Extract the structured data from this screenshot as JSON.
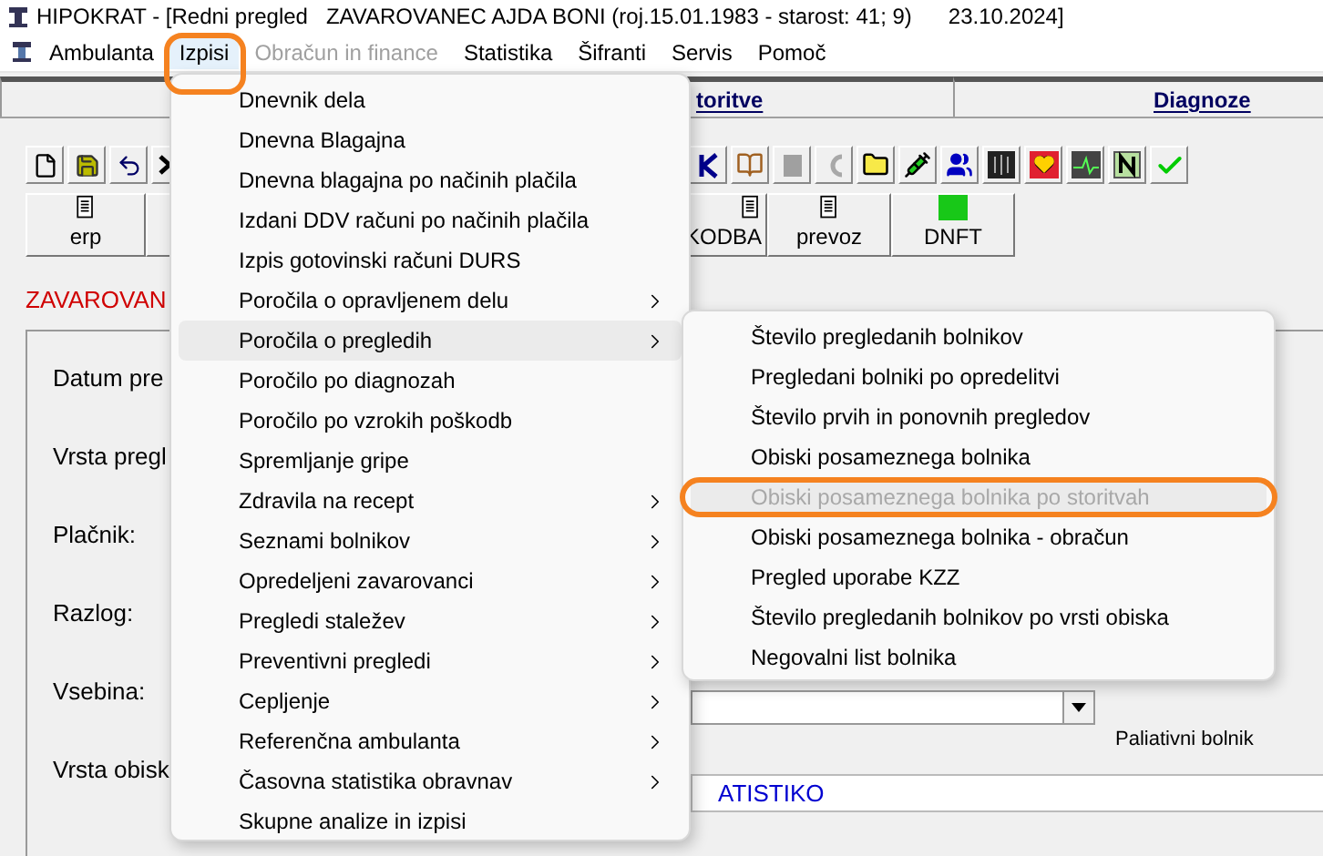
{
  "window": {
    "title": "HIPOKRAT - [Redni pregled   ZAVAROVANEC AJDA BONI (roj.15.01.1983 - starost: 41; 9)      23.10.2024]"
  },
  "menu_bar": [
    {
      "label": "Ambulanta",
      "selected": false,
      "disabled": false
    },
    {
      "label": "Izpisi",
      "selected": true,
      "disabled": false
    },
    {
      "label": "Obračun in finance",
      "selected": false,
      "disabled": true
    },
    {
      "label": "Statistika",
      "selected": false,
      "disabled": false
    },
    {
      "label": "Šifranti",
      "selected": false,
      "disabled": false
    },
    {
      "label": "Servis",
      "selected": false,
      "disabled": false
    },
    {
      "label": "Pomoč",
      "selected": false,
      "disabled": false
    }
  ],
  "tabs": [
    {
      "label": "toritve"
    },
    {
      "label": "Diagnoze"
    }
  ],
  "buttons": [
    {
      "label": "erp"
    },
    {
      "label": "KODBA"
    },
    {
      "label": "prevoz"
    },
    {
      "label": "DNFT",
      "kind": "green"
    }
  ],
  "banner": "ZAVAROVAN",
  "form_labels": [
    "Datum pre",
    "Vrsta pregl",
    "Plačnik:",
    "Razlog:",
    "Vsebina:",
    "Vrsta obisk"
  ],
  "checkbox_label": "Paliativni bolnik",
  "visit_type_field": {
    "value": "ATISTIKO"
  },
  "izpisi_menu": [
    {
      "label": "Dnevnik dela",
      "submenu": false,
      "highlighted": false
    },
    {
      "label": "Dnevna Blagajna",
      "submenu": false,
      "highlighted": false
    },
    {
      "label": "Dnevna blagajna po načinih plačila",
      "submenu": false,
      "highlighted": false
    },
    {
      "label": "Izdani DDV računi po načinih plačila",
      "submenu": false,
      "highlighted": false
    },
    {
      "label": "Izpis gotovinski računi DURS",
      "submenu": false,
      "highlighted": false
    },
    {
      "label": "Poročila o opravljenem delu",
      "submenu": true,
      "highlighted": false
    },
    {
      "label": "Poročila o pregledih",
      "submenu": true,
      "highlighted": true
    },
    {
      "label": "Poročilo po diagnozah",
      "submenu": false,
      "highlighted": false
    },
    {
      "label": "Poročilo po vzrokih poškodb",
      "submenu": false,
      "highlighted": false
    },
    {
      "label": "Spremljanje gripe",
      "submenu": false,
      "highlighted": false
    },
    {
      "label": "Zdravila na recept",
      "submenu": true,
      "highlighted": false
    },
    {
      "label": "Seznami bolnikov",
      "submenu": true,
      "highlighted": false
    },
    {
      "label": "Opredeljeni zavarovanci",
      "submenu": true,
      "highlighted": false
    },
    {
      "label": "Pregledi staležev",
      "submenu": true,
      "highlighted": false
    },
    {
      "label": "Preventivni pregledi",
      "submenu": true,
      "highlighted": false
    },
    {
      "label": "Cepljenje",
      "submenu": true,
      "highlighted": false
    },
    {
      "label": "Referenčna ambulanta",
      "submenu": true,
      "highlighted": false
    },
    {
      "label": "Časovna statistika obravnav",
      "submenu": true,
      "highlighted": false
    },
    {
      "label": "Skupne analize in izpisi",
      "submenu": false,
      "highlighted": false
    }
  ],
  "submenu": [
    {
      "label": "Število pregledanih bolnikov",
      "disabled": false,
      "highlighted": false
    },
    {
      "label": "Pregledani bolniki po opredelitvi",
      "disabled": false,
      "highlighted": false
    },
    {
      "label": "Število prvih in ponovnih pregledov",
      "disabled": false,
      "highlighted": false
    },
    {
      "label": "Obiski posameznega bolnika",
      "disabled": false,
      "highlighted": false
    },
    {
      "label": "Obiski posameznega bolnika po storitvah",
      "disabled": true,
      "highlighted": true
    },
    {
      "label": "Obiski posameznega bolnika - obračun",
      "disabled": false,
      "highlighted": false
    },
    {
      "label": "Pregled uporabe KZZ",
      "disabled": false,
      "highlighted": false
    },
    {
      "label": "Število pregledanih bolnikov po vrsti obiska",
      "disabled": false,
      "highlighted": false
    },
    {
      "label": "Negovalni list bolnika",
      "disabled": false,
      "highlighted": false
    }
  ]
}
